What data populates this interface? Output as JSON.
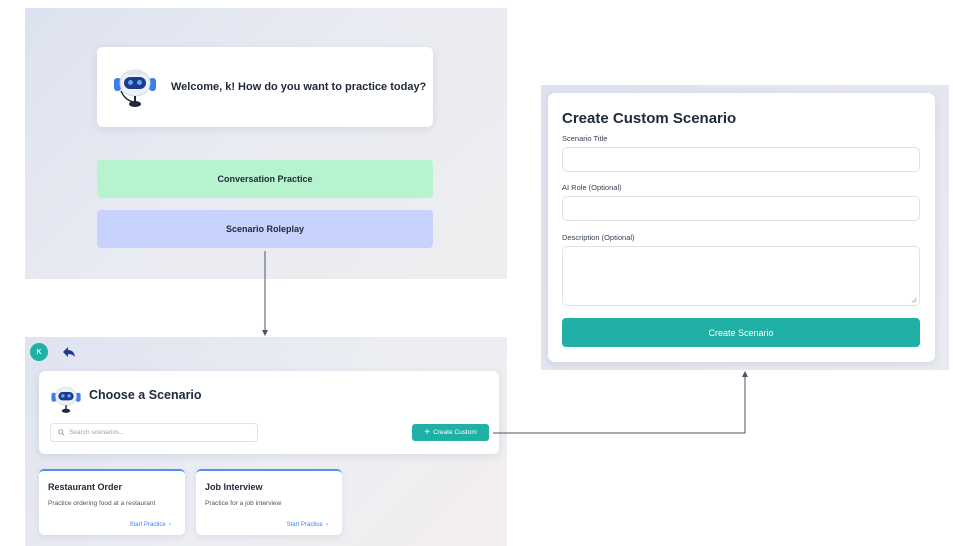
{
  "welcome": {
    "message": "Welcome, k! How do you want to practice today?",
    "modes": [
      "Conversation Practice",
      "Scenario Roleplay"
    ]
  },
  "chooser": {
    "user_initial": "K",
    "title": "Choose a Scenario",
    "search_placeholder": "Search scenarios...",
    "create_custom_label": "Create Custom",
    "scenarios": [
      {
        "title": "Restaurant Order",
        "description": "Practice ordering food at a restaurant",
        "action": "Start Practice"
      },
      {
        "title": "Job Interview",
        "description": "Practice for a job interview",
        "action": "Start Practice"
      }
    ]
  },
  "create_form": {
    "title": "Create Custom Scenario",
    "fields": [
      {
        "label": "Scenario Title",
        "value": ""
      },
      {
        "label": "AI Role (Optional)",
        "value": ""
      },
      {
        "label": "Description (Optional)",
        "value": ""
      }
    ],
    "submit_label": "Create Scenario"
  },
  "colors": {
    "accent_teal": "#21b0a6",
    "conversation_green": "#b7f3cf",
    "roleplay_blue": "#c7d2fd",
    "link_blue": "#3b82f6",
    "connector": "#4b5563"
  },
  "icons": [
    "robot-icon",
    "back-arrow-icon",
    "search-icon",
    "plus-icon",
    "chevron-right-icon",
    "resize-grip-icon"
  ]
}
